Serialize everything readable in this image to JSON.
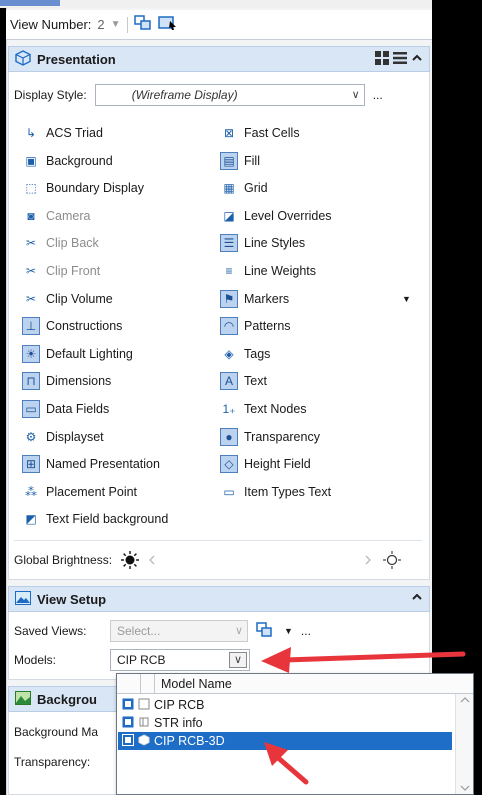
{
  "view_bar": {
    "label": "View Number:",
    "number": "2"
  },
  "presentation": {
    "title": "Presentation",
    "display_style_label": "Display Style:",
    "display_style_value": "(Wireframe Display)",
    "more": "...",
    "left_items": [
      {
        "label": "ACS Triad",
        "icon": "acs-triad-icon",
        "glyph": "↳",
        "disabled": false,
        "boxed": false
      },
      {
        "label": "Background",
        "icon": "background-icon",
        "glyph": "▣",
        "disabled": false,
        "boxed": false
      },
      {
        "label": "Boundary Display",
        "icon": "boundary-display-icon",
        "glyph": "⬚",
        "disabled": false,
        "boxed": false
      },
      {
        "label": "Camera",
        "icon": "camera-icon",
        "glyph": "◙",
        "disabled": true,
        "boxed": false
      },
      {
        "label": "Clip Back",
        "icon": "clip-back-icon",
        "glyph": "✂",
        "disabled": true,
        "boxed": false
      },
      {
        "label": "Clip Front",
        "icon": "clip-front-icon",
        "glyph": "✂",
        "disabled": true,
        "boxed": false
      },
      {
        "label": "Clip Volume",
        "icon": "clip-volume-icon",
        "glyph": "✂",
        "disabled": false,
        "boxed": false
      },
      {
        "label": "Constructions",
        "icon": "constructions-icon",
        "glyph": "⊥",
        "disabled": false,
        "boxed": true
      },
      {
        "label": "Default Lighting",
        "icon": "default-lighting-icon",
        "glyph": "☀",
        "disabled": false,
        "boxed": true
      },
      {
        "label": "Dimensions",
        "icon": "dimensions-icon",
        "glyph": "⊓",
        "disabled": false,
        "boxed": true
      },
      {
        "label": "Data Fields",
        "icon": "data-fields-icon",
        "glyph": "▭",
        "disabled": false,
        "boxed": true
      },
      {
        "label": "Displayset",
        "icon": "displayset-icon",
        "glyph": "⚙",
        "disabled": false,
        "boxed": false
      },
      {
        "label": "Named Presentation",
        "icon": "named-presentation-icon",
        "glyph": "⊞",
        "disabled": false,
        "boxed": true
      },
      {
        "label": "Placement Point",
        "icon": "placement-point-icon",
        "glyph": "⁂",
        "disabled": false,
        "boxed": false
      },
      {
        "label": "Text Field background",
        "icon": "text-field-background-icon",
        "glyph": "◩",
        "disabled": false,
        "boxed": false
      }
    ],
    "right_items": [
      {
        "label": "Fast Cells",
        "icon": "fast-cells-icon",
        "glyph": "⊠",
        "boxed": false
      },
      {
        "label": "Fill",
        "icon": "fill-icon",
        "glyph": "▤",
        "boxed": true
      },
      {
        "label": "Grid",
        "icon": "grid-icon",
        "glyph": "▦",
        "boxed": false
      },
      {
        "label": "Level Overrides",
        "icon": "level-overrides-icon",
        "glyph": "◪",
        "boxed": false
      },
      {
        "label": "Line Styles",
        "icon": "line-styles-icon",
        "glyph": "☰",
        "boxed": true
      },
      {
        "label": "Line Weights",
        "icon": "line-weights-icon",
        "glyph": "≡",
        "boxed": false
      },
      {
        "label": "Markers",
        "icon": "markers-icon",
        "glyph": "⚑",
        "boxed": true
      },
      {
        "label": "Patterns",
        "icon": "patterns-icon",
        "glyph": "◠",
        "boxed": true
      },
      {
        "label": "Tags",
        "icon": "tags-icon",
        "glyph": "◈",
        "boxed": false
      },
      {
        "label": "Text",
        "icon": "text-icon",
        "glyph": "A",
        "boxed": true
      },
      {
        "label": "Text Nodes",
        "icon": "text-nodes-icon",
        "glyph": "1₊",
        "boxed": false
      },
      {
        "label": "Transparency",
        "icon": "transparency-icon",
        "glyph": "●",
        "boxed": true
      },
      {
        "label": "Height Field",
        "icon": "height-field-icon",
        "glyph": "◇",
        "boxed": true
      },
      {
        "label": "Item Types Text",
        "icon": "item-types-text-icon",
        "glyph": "▭",
        "boxed": false
      }
    ],
    "brightness_label": "Global Brightness:"
  },
  "view_setup": {
    "title": "View Setup",
    "saved_views_label": "Saved Views:",
    "saved_views_placeholder": "Select...",
    "more": "...",
    "models_label": "Models:",
    "models_value": "CIP RCB"
  },
  "background_section": {
    "title": "Backgrou",
    "background_map_label": "Background Ma",
    "transparency_label": "Transparency:"
  },
  "models_dropdown": {
    "column_header": "Model Name",
    "rows": [
      {
        "name": "CIP RCB",
        "selected": false
      },
      {
        "name": "STR info",
        "selected": false
      },
      {
        "name": "CIP RCB-3D",
        "selected": true
      }
    ]
  },
  "colors": {
    "header_bg": "#d9e6f6",
    "accent": "#1e6ec8",
    "annotation_arrow": "#e8353b"
  }
}
